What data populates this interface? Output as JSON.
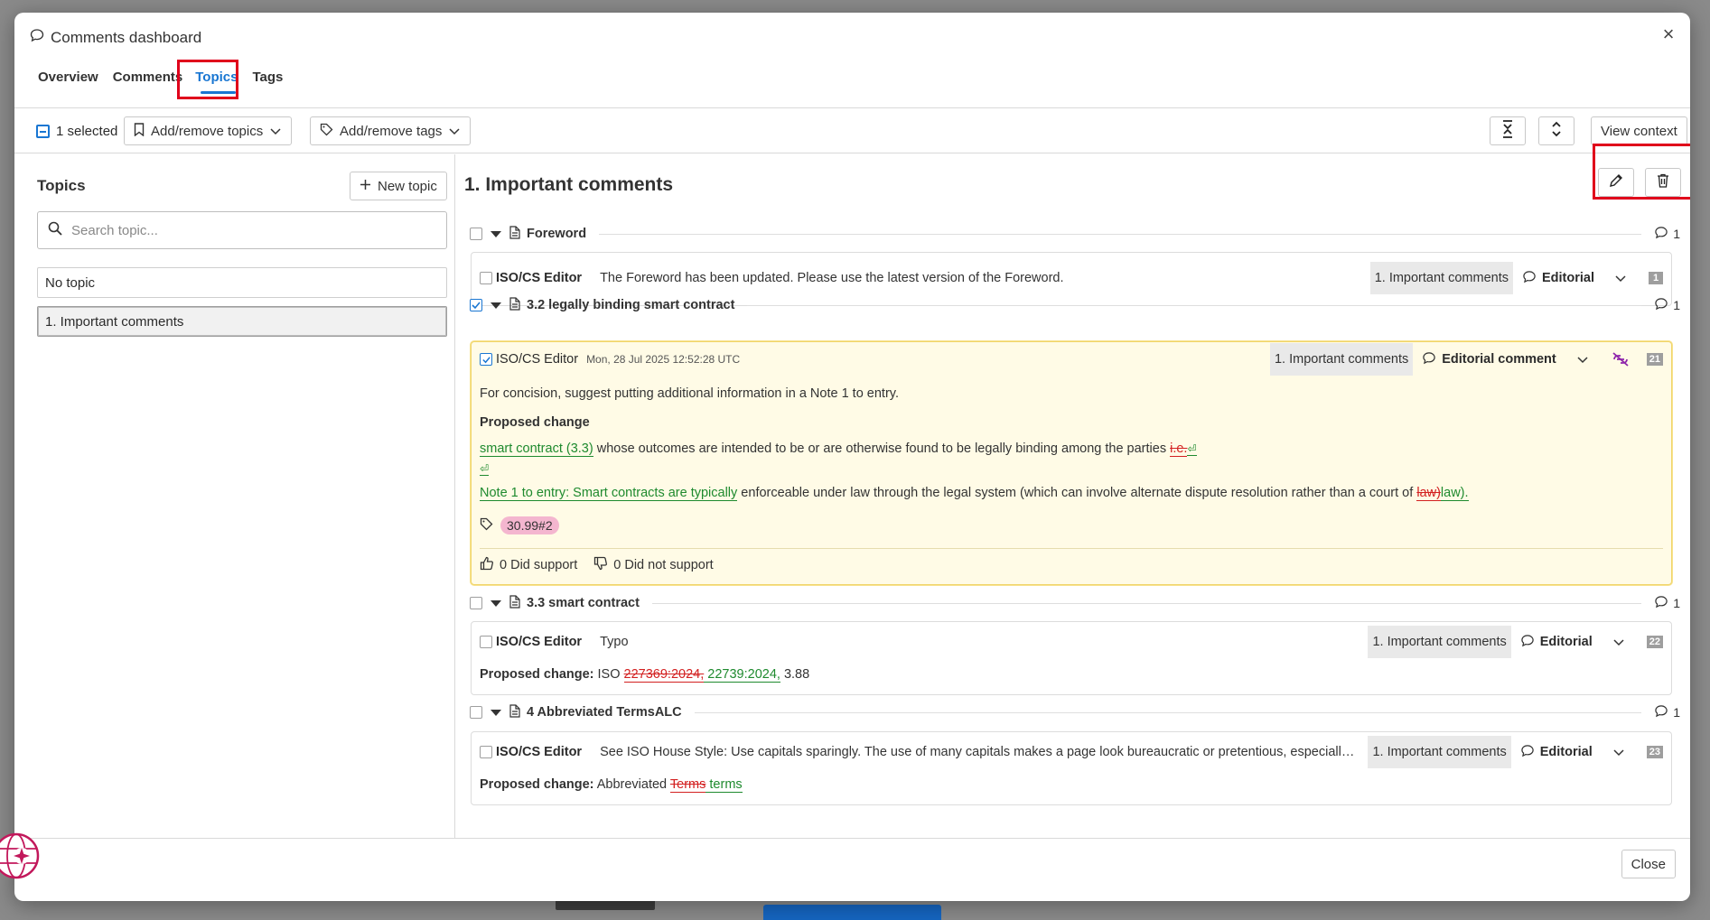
{
  "modal": {
    "title": "Comments dashboard",
    "close_label": "×"
  },
  "tabs": [
    {
      "label": "Overview"
    },
    {
      "label": "Comments"
    },
    {
      "label": "Topics"
    },
    {
      "label": "Tags"
    }
  ],
  "active_tab": "Topics",
  "toolbar": {
    "selected_text": "1 selected",
    "add_topics_label": "Add/remove topics",
    "add_tags_label": "Add/remove tags",
    "view_context_label": "View context"
  },
  "topics_panel": {
    "title": "Topics",
    "new_topic_label": "New topic",
    "search_placeholder": "Search topic...",
    "items": [
      {
        "label": "No topic",
        "selected": false
      },
      {
        "label": "1. Important comments",
        "selected": true
      }
    ]
  },
  "detail": {
    "title": "1. Important comments",
    "sections": [
      {
        "heading": "Foreword",
        "count": "1",
        "checked": false,
        "comment": {
          "author": "ISO/CS Editor",
          "body": "The Foreword has been updated. Please use the latest version of the Foreword.",
          "topic": "1. Important comments",
          "type": "Editorial",
          "number": "1"
        }
      },
      {
        "heading": "3.2 legally binding smart contract",
        "count": "1",
        "checked": true,
        "comment": {
          "author": "ISO/CS Editor",
          "date": "Mon, 28 Jul 2025 12:52:28 UTC",
          "body": "For concision, suggest putting additional information in a Note 1 to entry.",
          "proposed_label": "Proposed change",
          "line1_ins": "smart contract (3.3)",
          "line1_text": " whose outcomes are intended to be or are otherwise found to be legally binding among the parties ",
          "line1_del": "i.e.",
          "line2_ins": "⏎",
          "line3_ins": " Note 1 to entry: Smart contracts are typically",
          "line3_text": " enforceable under law through the legal system (which can involve alternate dispute resolution rather than a court of ",
          "line3_del": "law)",
          "line3_ins2": "law).",
          "tag": "30.99#2",
          "topic": "1. Important comments",
          "type": "Editorial comment",
          "number": "21",
          "support_label": "0 Did support",
          "not_support_label": "0 Did not support"
        }
      },
      {
        "heading": "3.3 smart contract",
        "count": "1",
        "checked": false,
        "comment": {
          "author": "ISO/CS Editor",
          "body": "Typo",
          "proposed_label": "Proposed change:",
          "proposed_prefix": " ISO ",
          "proposed_del": "227369:2024,",
          "proposed_ins": " 22739:2024,",
          "proposed_suffix": " 3.88",
          "topic": "1. Important comments",
          "type": "Editorial",
          "number": "22"
        }
      },
      {
        "heading": "4 Abbreviated TermsALC",
        "count": "1",
        "checked": false,
        "comment": {
          "author": "ISO/CS Editor",
          "body": "See ISO House Style: Use capitals sparingly. The use of many capitals makes a page look bureaucratic or pretentious, especially in titles and headings.",
          "proposed_label": "Proposed change:",
          "proposed_prefix": " Abbreviated ",
          "proposed_del": "Terms",
          "proposed_ins": " terms",
          "topic": "1. Important comments",
          "type": "Editorial",
          "number": "23"
        }
      }
    ]
  },
  "footer": {
    "close_label": "Close"
  },
  "colors": {
    "accent": "#1976d2",
    "highlight_box": "#e0001b",
    "insert": "#1e8a2e",
    "delete": "#d32020",
    "selected_card_bg": "#fffbe6",
    "tag_chip": "#f4b6cf"
  }
}
